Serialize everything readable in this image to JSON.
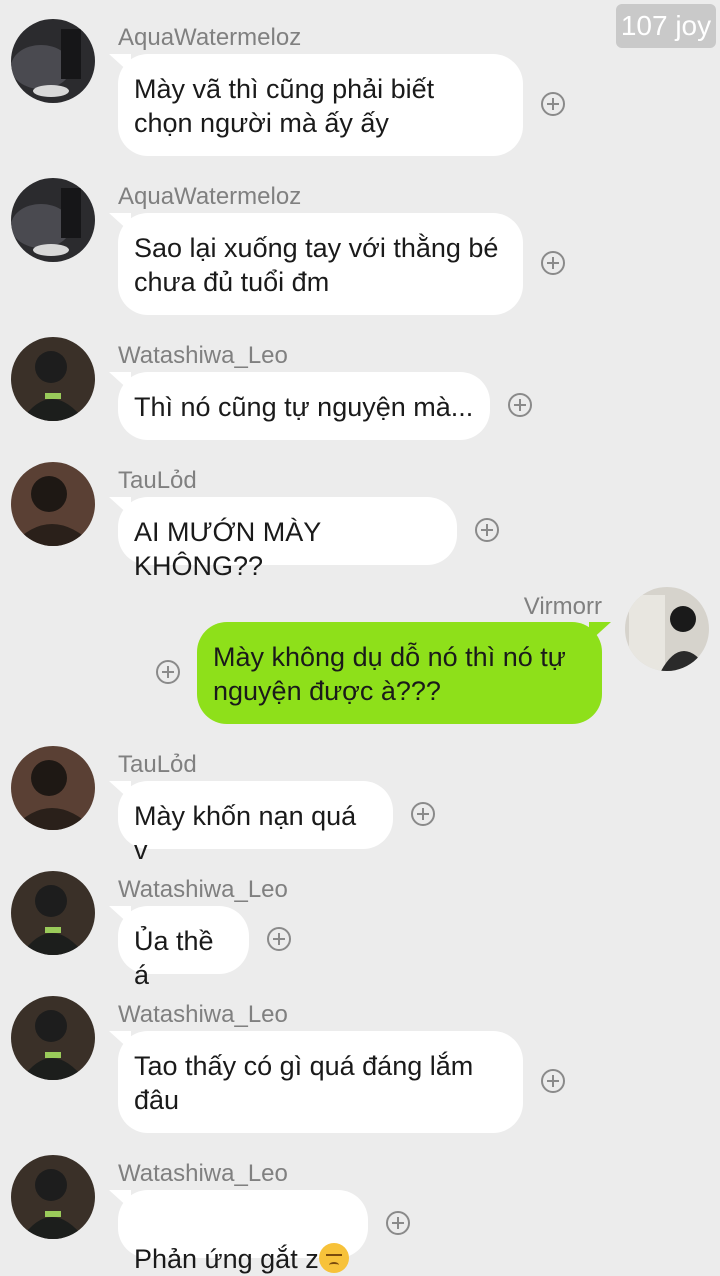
{
  "reaction_badge": "107 joy",
  "messages": [
    {
      "sender": "AquaWatermeloz",
      "text": "Mày vã thì cũng phải biết\nchọn người mà ấy ấy",
      "direction": "incoming",
      "avatar": "aqua-avatar"
    },
    {
      "sender": "AquaWatermeloz",
      "text": "Sao lại xuống tay với thằng bé\nchưa đủ tuổi đm",
      "direction": "incoming",
      "avatar": "aqua-avatar"
    },
    {
      "sender": "Watashiwa_Leo",
      "text": "Thì nó cũng tự nguyện mà...",
      "direction": "incoming",
      "avatar": "leo-avatar"
    },
    {
      "sender": "TauLỏd",
      "text": "AI MƯỚN MÀY KHÔNG??",
      "direction": "incoming",
      "avatar": "taulod-avatar"
    },
    {
      "sender": "Virmorr",
      "text": "Mày không dụ dỗ nó thì nó tự\nnguyện được à???",
      "direction": "outgoing",
      "avatar": "virmorr-avatar"
    },
    {
      "sender": "TauLỏd",
      "text": "Mày khốn nạn quá v",
      "direction": "incoming",
      "avatar": "taulod-avatar"
    },
    {
      "sender": "Watashiwa_Leo",
      "text": "Ủa thề á",
      "direction": "incoming",
      "avatar": "leo-avatar"
    },
    {
      "sender": "Watashiwa_Leo",
      "text": "Tao thấy có gì quá đáng lắm\nđâu",
      "direction": "incoming",
      "avatar": "leo-avatar"
    },
    {
      "sender": "Watashiwa_Leo",
      "text": "Phản ứng gắt z",
      "emoji": "pensive-face",
      "direction": "incoming",
      "avatar": "leo-avatar"
    }
  ],
  "colors": {
    "background": "#ececec",
    "incoming_bubble": "#ffffff",
    "outgoing_bubble": "#8ee01a",
    "sender_name": "#808080"
  }
}
